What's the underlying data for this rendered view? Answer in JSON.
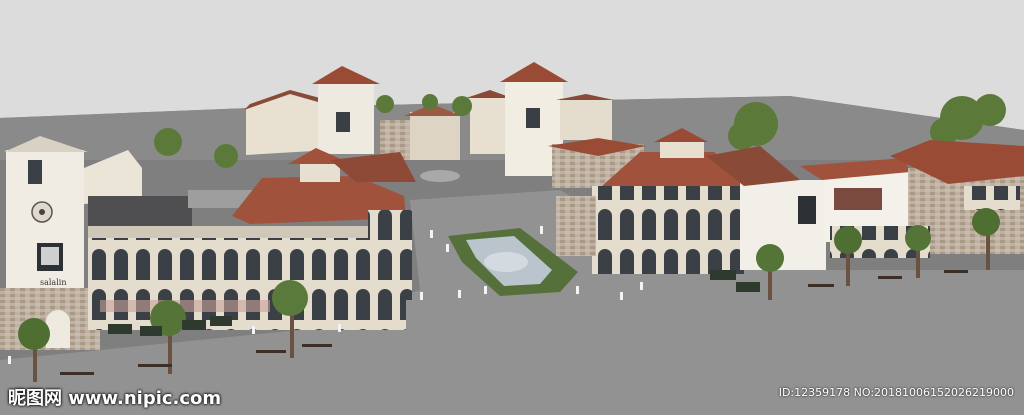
{
  "scene": {
    "sky_color": "#dcdcdc",
    "ground_color": "#8c8c8c",
    "roof_color": "#a0523d",
    "wall_color": "#e9e3d5",
    "stone_color": "#b8a898"
  },
  "signs": {
    "left_tower": "salalin"
  },
  "watermark": {
    "site": "昵图网 www.nipic.com",
    "id_text": "ID:12359178 NO:20181006152026219000"
  }
}
